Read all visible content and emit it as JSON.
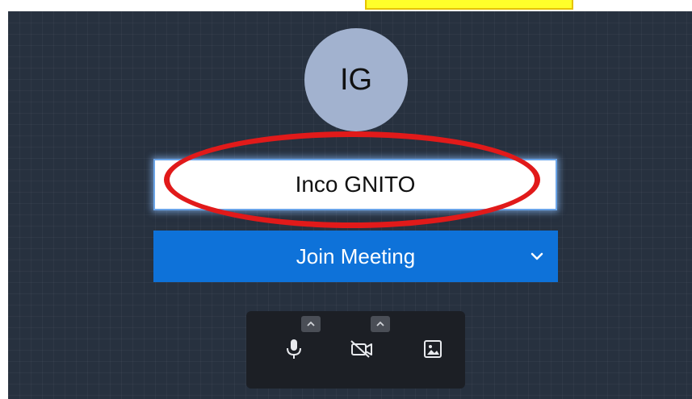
{
  "avatar": {
    "initials": "IG"
  },
  "name_field": {
    "value": "Inco GNITO"
  },
  "join": {
    "label": "Join Meeting"
  },
  "controls": {
    "items": [
      {
        "name": "microphone",
        "icon": "microphone-icon"
      },
      {
        "name": "camera-off",
        "icon": "video-off-icon"
      },
      {
        "name": "background",
        "icon": "image-icon"
      }
    ]
  },
  "colors": {
    "panel_bg": "#27313f",
    "avatar_bg": "#a2b2cf",
    "join_bg": "#0e72d9",
    "annotation": "#e11a1a",
    "highlight": "#ffff2a"
  }
}
